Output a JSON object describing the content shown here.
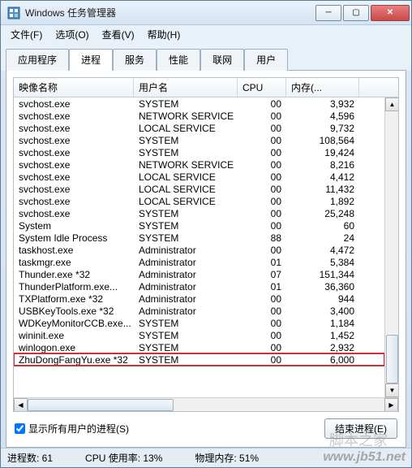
{
  "titlebar": {
    "title": "Windows 任务管理器"
  },
  "window_controls": {
    "min": "─",
    "max": "▢",
    "close": "✕"
  },
  "menu": {
    "file": "文件(F)",
    "options": "选项(O)",
    "view": "查看(V)",
    "help": "帮助(H)"
  },
  "tabs": {
    "apps": "应用程序",
    "processes": "进程",
    "services": "服务",
    "performance": "性能",
    "network": "联网",
    "users": "用户"
  },
  "columns": {
    "name": "映像名称",
    "user": "用户名",
    "cpu": "CPU",
    "mem": "内存(..."
  },
  "processes": [
    {
      "name": "svchost.exe",
      "user": "SYSTEM",
      "cpu": "00",
      "mem": "3,932"
    },
    {
      "name": "svchost.exe",
      "user": "NETWORK SERVICE",
      "cpu": "00",
      "mem": "4,596"
    },
    {
      "name": "svchost.exe",
      "user": "LOCAL SERVICE",
      "cpu": "00",
      "mem": "9,732"
    },
    {
      "name": "svchost.exe",
      "user": "SYSTEM",
      "cpu": "00",
      "mem": "108,564"
    },
    {
      "name": "svchost.exe",
      "user": "SYSTEM",
      "cpu": "00",
      "mem": "19,424"
    },
    {
      "name": "svchost.exe",
      "user": "NETWORK SERVICE",
      "cpu": "00",
      "mem": "8,216"
    },
    {
      "name": "svchost.exe",
      "user": "LOCAL SERVICE",
      "cpu": "00",
      "mem": "4,412"
    },
    {
      "name": "svchost.exe",
      "user": "LOCAL SERVICE",
      "cpu": "00",
      "mem": "11,432"
    },
    {
      "name": "svchost.exe",
      "user": "LOCAL SERVICE",
      "cpu": "00",
      "mem": "1,892"
    },
    {
      "name": "svchost.exe",
      "user": "SYSTEM",
      "cpu": "00",
      "mem": "25,248"
    },
    {
      "name": "System",
      "user": "SYSTEM",
      "cpu": "00",
      "mem": "60"
    },
    {
      "name": "System Idle Process",
      "user": "SYSTEM",
      "cpu": "88",
      "mem": "24"
    },
    {
      "name": "taskhost.exe",
      "user": "Administrator",
      "cpu": "00",
      "mem": "4,472"
    },
    {
      "name": "taskmgr.exe",
      "user": "Administrator",
      "cpu": "01",
      "mem": "5,384"
    },
    {
      "name": "Thunder.exe *32",
      "user": "Administrator",
      "cpu": "07",
      "mem": "151,344"
    },
    {
      "name": "ThunderPlatform.exe...",
      "user": "Administrator",
      "cpu": "01",
      "mem": "36,360"
    },
    {
      "name": "TXPlatform.exe *32",
      "user": "Administrator",
      "cpu": "00",
      "mem": "944"
    },
    {
      "name": "USBKeyTools.exe *32",
      "user": "Administrator",
      "cpu": "00",
      "mem": "3,400"
    },
    {
      "name": "WDKeyMonitorCCB.exe...",
      "user": "SYSTEM",
      "cpu": "00",
      "mem": "1,184"
    },
    {
      "name": "wininit.exe",
      "user": "SYSTEM",
      "cpu": "00",
      "mem": "1,452"
    },
    {
      "name": "winlogon.exe",
      "user": "SYSTEM",
      "cpu": "00",
      "mem": "2,932"
    },
    {
      "name": "ZhuDongFangYu.exe *32",
      "user": "SYSTEM",
      "cpu": "00",
      "mem": "6,000"
    }
  ],
  "highlight_index": 21,
  "show_all_users": "显示所有用户的进程(S)",
  "end_process": "结束进程(E)",
  "status": {
    "proc_count": "进程数: 61",
    "cpu_usage": "CPU 使用率: 13%",
    "phys_mem": "物理内存: 51%"
  },
  "watermark": {
    "cn": "脚本之家",
    "url": "www.jb51.net"
  }
}
